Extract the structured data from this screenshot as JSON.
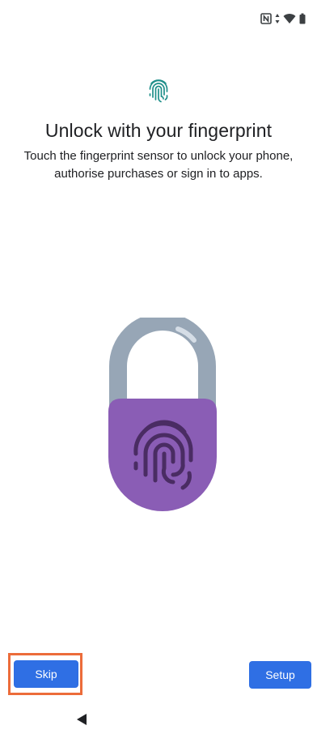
{
  "status_bar": {
    "icons": [
      "nfc-icon",
      "data-arrows-icon",
      "wifi-icon",
      "battery-icon"
    ]
  },
  "header": {
    "icon": "fingerprint-icon",
    "title": "Unlock with your fingerprint",
    "subtitle": "Touch the fingerprint sensor to unlock your phone, authorise purchases or sign in to apps."
  },
  "illustration": {
    "icon": "padlock-fingerprint-icon",
    "colors": {
      "body": "#8a5db5",
      "shackle": "#97a6b6",
      "fingerprint": "#4a2c63"
    }
  },
  "actions": {
    "skip_label": "Skip",
    "setup_label": "Setup",
    "button_color": "#2f6fe4",
    "highlight_color": "#ec6c3a"
  },
  "nav_bar": {
    "back_icon": "back-triangle-icon"
  }
}
